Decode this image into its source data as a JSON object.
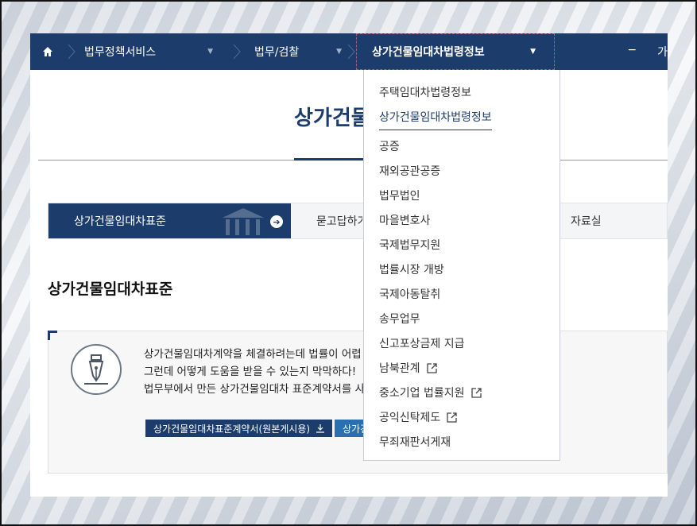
{
  "nav": {
    "home_icon": "home-icon",
    "items": [
      {
        "label": "법무정책서비스"
      },
      {
        "label": "법무/검찰"
      },
      {
        "label": "상가건물임대차법령정보"
      }
    ],
    "extra": [
      "−",
      "가"
    ]
  },
  "page": {
    "title": "상가건물임대차법령정보"
  },
  "tabs": [
    {
      "label": "상가건물임대차표준"
    },
    {
      "label": "묻고답하기"
    },
    {
      "label": "자료실"
    }
  ],
  "section_title": "상가건물임대차표준",
  "info": {
    "lines": [
      "상가건물임대차계약을 체결하려는데 법률이 어렵",
      "그런데 어떻게 도움을 받을 수 있는지 막막하다!",
      "법무부에서 만든 상가건물임대차 표준계약서를 사"
    ],
    "download_primary": "상가건물임대차표준계약서(원본게시용)",
    "download_secondary": "상가건"
  },
  "dropdown": {
    "items": [
      {
        "label": "주택임대차법령정보",
        "external": false
      },
      {
        "label": "상가건물임대차법령정보",
        "external": false,
        "active": true
      },
      {
        "label": "공증",
        "external": false
      },
      {
        "label": "재외공관공증",
        "external": false
      },
      {
        "label": "법무법인",
        "external": false
      },
      {
        "label": "마을변호사",
        "external": false
      },
      {
        "label": "국제법무지원",
        "external": false
      },
      {
        "label": "법률시장 개방",
        "external": false
      },
      {
        "label": "국제아동탈취",
        "external": false
      },
      {
        "label": "송무업무",
        "external": false
      },
      {
        "label": "신고포상금제 지급",
        "external": false
      },
      {
        "label": "남북관계",
        "external": true
      },
      {
        "label": "중소기업 법률지원",
        "external": true
      },
      {
        "label": "공익신탁제도",
        "external": true
      },
      {
        "label": "무죄재판서게재",
        "external": false
      }
    ]
  },
  "colors": {
    "navy": "#1c3d6b",
    "blue": "#2a6fb0"
  }
}
